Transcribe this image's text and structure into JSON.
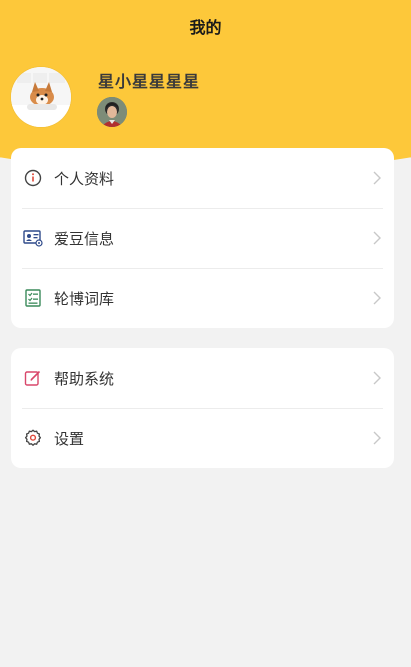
{
  "header": {
    "title": "我的",
    "background_color": "#fdc83a"
  },
  "profile": {
    "username": "星小星星星星",
    "avatar_icon": "dog-avatar",
    "idol_avatar_icon": "idol-photo-avatar"
  },
  "menu_groups": [
    {
      "items": [
        {
          "label": "个人资料",
          "icon": "info-circle-icon"
        },
        {
          "label": "爱豆信息",
          "icon": "id-card-icon"
        },
        {
          "label": "轮博词库",
          "icon": "checklist-icon"
        }
      ]
    },
    {
      "items": [
        {
          "label": "帮助系统",
          "icon": "edit-icon"
        },
        {
          "label": "设置",
          "icon": "gear-icon"
        }
      ]
    }
  ],
  "colors": {
    "accent": "#fdc83a",
    "page_background": "#f2f2f2",
    "card_background": "#ffffff"
  }
}
